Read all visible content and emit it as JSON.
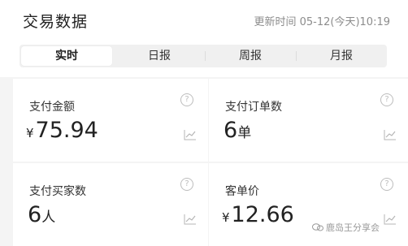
{
  "header": {
    "title": "交易数据",
    "update_time": "更新时间 05-12(今天)10:19"
  },
  "tabs": [
    {
      "label": "实时",
      "active": true
    },
    {
      "label": "日报",
      "active": false
    },
    {
      "label": "周报",
      "active": false
    },
    {
      "label": "月报",
      "active": false
    }
  ],
  "metrics": [
    {
      "label": "支付金额",
      "currency": "¥",
      "value": "75.94",
      "unit": ""
    },
    {
      "label": "支付订单数",
      "currency": "",
      "value": "6",
      "unit": "单"
    },
    {
      "label": "支付买家数",
      "currency": "",
      "value": "6",
      "unit": "人"
    },
    {
      "label": "客单价",
      "currency": "¥",
      "value": "12.66",
      "unit": ""
    }
  ],
  "icons": {
    "help": "question-circle-icon",
    "trend": "trend-chart-icon"
  },
  "watermark": "鹿岛王分享会",
  "colors": {
    "background": "#f4f4f4",
    "card": "#ffffff",
    "text": "#222222",
    "muted": "#8c8c8c"
  }
}
